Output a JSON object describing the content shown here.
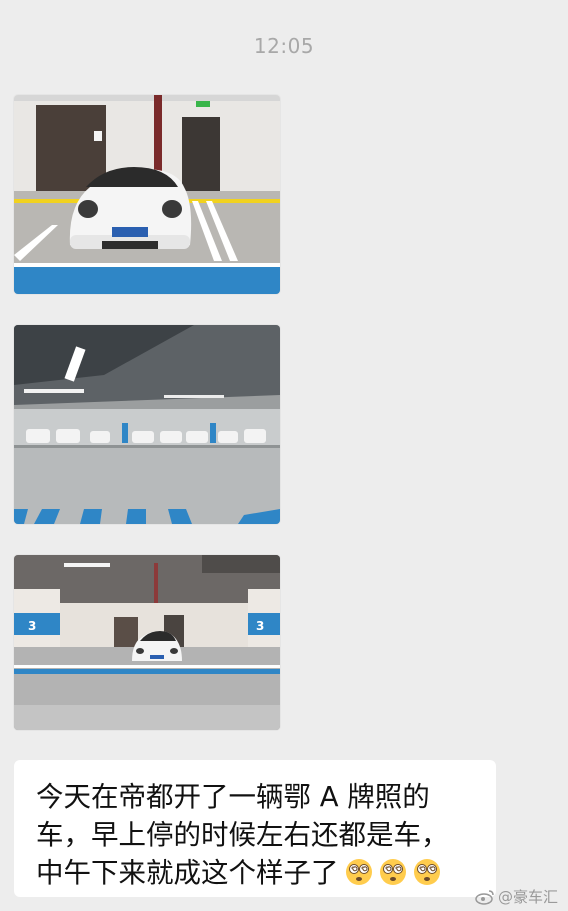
{
  "chat": {
    "timestamp": "12:05",
    "photos": [
      {
        "subject": "white Porsche parked alone in underground garage, near exit doors"
      },
      {
        "subject": "underground garage with rows of parked cars and blue floor markings"
      },
      {
        "subject": "white Porsche parked alone between pillars labeled 3"
      }
    ],
    "photo3_pillar_label": "3",
    "message": {
      "line1": "今天在帝都开了一辆鄂 A 牌照的",
      "line2": "车，早上停的时候左右还都是车，",
      "line3": "中午下来就成这个样子了",
      "emoji": [
        "dizzy-face-emoji",
        "dizzy-face-emoji",
        "dizzy-face-emoji"
      ]
    }
  },
  "watermark": {
    "icon": "weibo-icon",
    "text": "@豪车汇"
  },
  "colors": {
    "background": "#ededed",
    "bubble": "#ffffff",
    "timestamp": "#a8a8a8",
    "floor_blue": "#2f86c6"
  }
}
